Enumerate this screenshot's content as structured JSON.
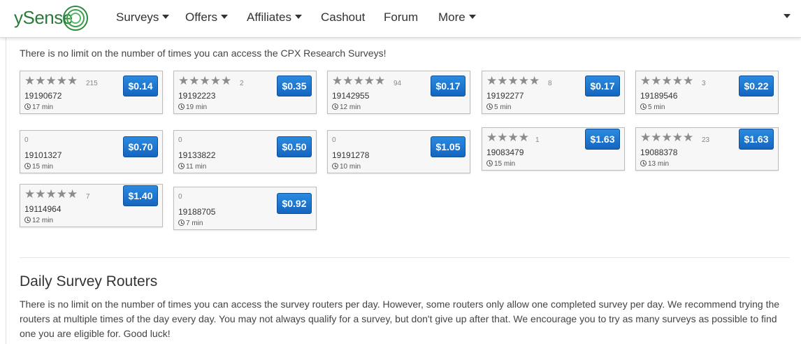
{
  "brand": {
    "name": "ySense",
    "color": "#2c7a3a"
  },
  "nav": {
    "items": [
      {
        "label": "Surveys",
        "dropdown": true
      },
      {
        "label": "Offers",
        "dropdown": true
      },
      {
        "label": "Affiliates",
        "dropdown": true
      },
      {
        "label": "Cashout",
        "dropdown": false
      },
      {
        "label": "Forum",
        "dropdown": false
      },
      {
        "label": "More",
        "dropdown": true
      }
    ],
    "user_menu_icon": "caret-down-icon"
  },
  "cpx": {
    "intro": "There is no limit on the number of times you can access the CPX Research Surveys!",
    "surveys": [
      {
        "stars": 5,
        "rating_count": "215",
        "id": "19190672",
        "time": "17 min",
        "price": "$0.14"
      },
      {
        "stars": 5,
        "rating_count": "2",
        "id": "19192223",
        "time": "19 min",
        "price": "$0.35"
      },
      {
        "stars": 5,
        "rating_count": "94",
        "id": "19142955",
        "time": "12 min",
        "price": "$0.17"
      },
      {
        "stars": 5,
        "rating_count": "8",
        "id": "19192277",
        "time": "5 min",
        "price": "$0.17"
      },
      {
        "stars": 5,
        "rating_count": "3",
        "id": "19189546",
        "time": "5 min",
        "price": "$0.22"
      },
      {
        "stars": 0,
        "rating_count": "0",
        "id": "19101327",
        "time": "15 min",
        "price": "$0.70"
      },
      {
        "stars": 0,
        "rating_count": "0",
        "id": "19133822",
        "time": "11 min",
        "price": "$0.50"
      },
      {
        "stars": 0,
        "rating_count": "0",
        "id": "19191278",
        "time": "10 min",
        "price": "$1.05"
      },
      {
        "stars": 4,
        "rating_count": "1",
        "id": "19083479",
        "time": "15 min",
        "price": "$1.63"
      },
      {
        "stars": 5,
        "rating_count": "23",
        "id": "19088378",
        "time": "13 min",
        "price": "$1.63"
      },
      {
        "stars": 5,
        "rating_count": "7",
        "id": "19114964",
        "time": "12 min",
        "price": "$1.40"
      },
      {
        "stars": 0,
        "rating_count": "0",
        "id": "19188705",
        "time": "7 min",
        "price": "$0.92"
      }
    ],
    "price_color": "#1a73d1",
    "star_color": "#8c8c8c"
  },
  "routers": {
    "title": "Daily Survey Routers",
    "text": "There is no limit on the number of times you can access the survey routers per day. However, some routers only allow one completed survey per day. We recommend trying the routers at multiple times of the day every day. You may not always qualify for a survey, but don't give up after that. We encourage you to try as many surveys as possible to find one you are eligible for. Good luck!"
  }
}
